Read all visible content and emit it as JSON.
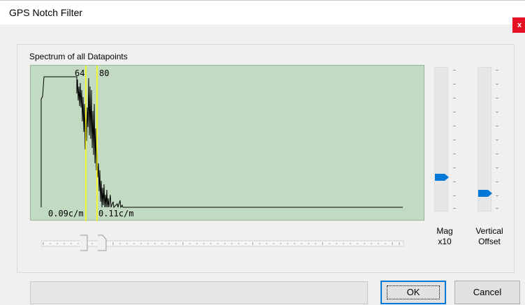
{
  "window": {
    "title": "GPS Notch Filter",
    "close_glyph": "x"
  },
  "spectrum": {
    "label": "Spectrum of all Datapoints",
    "marker_left_index": "64",
    "marker_right_index": "80",
    "marker_left_freq": "0.09c/m",
    "marker_right_freq": "0.11c/m",
    "background_color": "#c2dac2",
    "marker_color": "#ffff00"
  },
  "mag_slider": {
    "label_line1": "Mag",
    "label_line2": "x10",
    "level": 0.22
  },
  "offset_slider": {
    "label_line1": "Vertical",
    "label_line2": "Offset",
    "level": 0.1
  },
  "notch_slider": {
    "position": 0.12
  },
  "status_text": "",
  "buttons": {
    "ok": "OK",
    "cancel": "Cancel"
  },
  "accent_color": "#0078d7"
}
